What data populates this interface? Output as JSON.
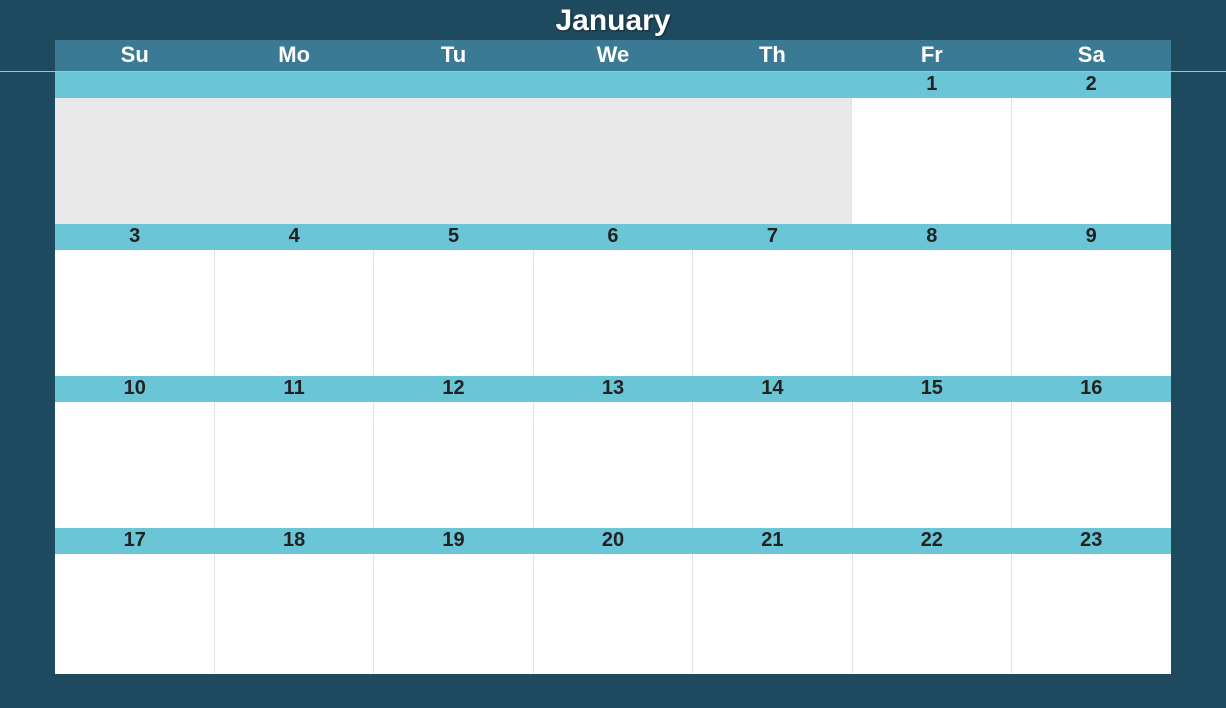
{
  "month_title": "January",
  "weekdays": [
    "Su",
    "Mo",
    "Tu",
    "We",
    "Th",
    "Fr",
    "Sa"
  ],
  "weeks": [
    {
      "dates": [
        "",
        "",
        "",
        "",
        "",
        "1",
        "2"
      ],
      "active": [
        false,
        false,
        false,
        false,
        false,
        true,
        true
      ]
    },
    {
      "dates": [
        "3",
        "4",
        "5",
        "6",
        "7",
        "8",
        "9"
      ],
      "active": [
        true,
        true,
        true,
        true,
        true,
        true,
        true
      ]
    },
    {
      "dates": [
        "10",
        "11",
        "12",
        "13",
        "14",
        "15",
        "16"
      ],
      "active": [
        true,
        true,
        true,
        true,
        true,
        true,
        true
      ]
    },
    {
      "dates": [
        "17",
        "18",
        "19",
        "20",
        "21",
        "22",
        "23"
      ],
      "active": [
        true,
        true,
        true,
        true,
        true,
        true,
        true
      ]
    }
  ]
}
